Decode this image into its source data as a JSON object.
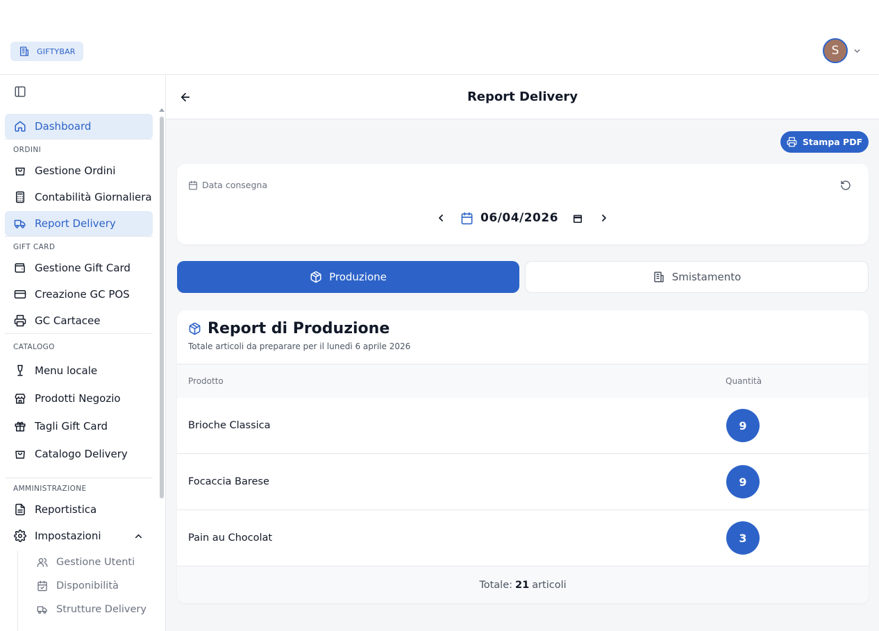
{
  "brand": {
    "label": "GIFTYBAR"
  },
  "user": {
    "initial": "S"
  },
  "colors": {
    "accent": "#2d63c8",
    "accent_light": "#e3ecf9",
    "background": "#f5f6f8"
  },
  "sidebar": {
    "dashboard": "Dashboard",
    "sections": {
      "ordini": "ORDINI",
      "gift_card": "GIFT CARD",
      "catalogo": "CATALOGO",
      "amministrazione": "AMMINISTRAZIONE"
    },
    "items": {
      "gestione_ordini": "Gestione Ordini",
      "contabilita": "Contabilità Giornaliera",
      "report_delivery": "Report Delivery",
      "gestione_gift_card": "Gestione Gift Card",
      "creazione_gc_pos": "Creazione GC POS",
      "gc_cartacee": "GC Cartacee",
      "menu_locale": "Menu locale",
      "prodotti_negozio": "Prodotti Negozio",
      "tagli_gift_card": "Tagli Gift Card",
      "catalogo_delivery": "Catalogo Delivery",
      "reportistica": "Reportistica",
      "impostazioni": "Impostazioni"
    },
    "sub_items": {
      "gestione_utenti": "Gestione Utenti",
      "disponibilita": "Disponibilità",
      "strutture_delivery": "Strutture Delivery"
    }
  },
  "header": {
    "title": "Report Delivery"
  },
  "toolbar": {
    "print_pdf": "Stampa PDF"
  },
  "date_filter": {
    "label": "Data consegna",
    "value": "06/04/2026"
  },
  "tabs": {
    "produzione": "Produzione",
    "smistamento": "Smistamento"
  },
  "report": {
    "title": "Report di Produzione",
    "subtitle": "Totale articoli da preparare per il lunedì 6 aprile 2026",
    "columns": {
      "product": "Prodotto",
      "quantity": "Quantità"
    },
    "rows": [
      {
        "name": "Brioche Classica",
        "qty": "9"
      },
      {
        "name": "Focaccia Barese",
        "qty": "9"
      },
      {
        "name": "Pain au Chocolat",
        "qty": "3"
      }
    ],
    "total": {
      "label": "Totale:",
      "value": "21",
      "unit": "articoli"
    }
  }
}
